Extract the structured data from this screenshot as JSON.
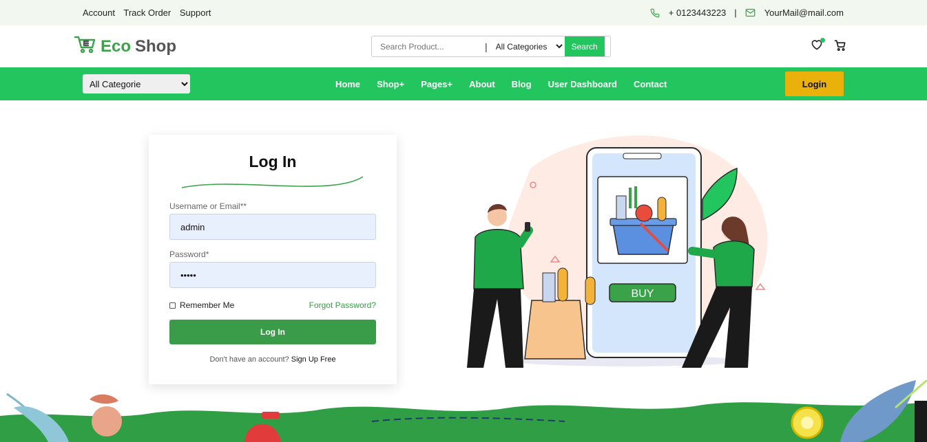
{
  "topbar": {
    "links": [
      "Account",
      "Track Order",
      "Support"
    ],
    "phone": "+ 0123443223",
    "separator": "|",
    "email": "YourMail@mail.com"
  },
  "header": {
    "logo_part1": "Eco",
    "logo_part2": "Shop",
    "search_placeholder": "Search Product...",
    "search_separator": "|",
    "category_selected": "All Categories",
    "search_button": "Search"
  },
  "navbar": {
    "category_selected": "All Categorie",
    "items": [
      "Home",
      "Shop+",
      "Pages+",
      "About",
      "Blog",
      "User Dashboard",
      "Contact"
    ],
    "login_button": "Login"
  },
  "login_form": {
    "title": "Log In",
    "username_label": "Username or Email**",
    "username_value": "admin",
    "password_label": "Password*",
    "password_value": "•••••",
    "remember_label": "Remember Me",
    "forgot_label": "Forgot Password?",
    "submit_label": "Log In",
    "signup_prompt": "Don't have an account?",
    "signup_link": "Sign Up Free"
  },
  "illustration": {
    "buy_label": "BUY"
  },
  "colors": {
    "primary_green": "#22c55e",
    "button_green": "#3a9b48",
    "login_yellow": "#e9b10a",
    "topbar_bg": "#f2f8ef"
  }
}
